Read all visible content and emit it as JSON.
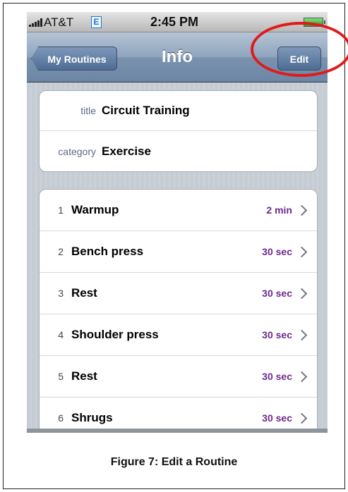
{
  "status_bar": {
    "carrier": "AT&T",
    "network": "E",
    "time": "2:45 PM"
  },
  "nav": {
    "back_label": "My Routines",
    "title": "Info",
    "edit_label": "Edit"
  },
  "info": {
    "rows": [
      {
        "label": "title",
        "value": "Circuit Training"
      },
      {
        "label": "category",
        "value": "Exercise"
      }
    ]
  },
  "steps": [
    {
      "num": "1",
      "name": "Warmup",
      "duration": "2 min"
    },
    {
      "num": "2",
      "name": "Bench press",
      "duration": "30 sec"
    },
    {
      "num": "3",
      "name": "Rest",
      "duration": "30 sec"
    },
    {
      "num": "4",
      "name": "Shoulder press",
      "duration": "30 sec"
    },
    {
      "num": "5",
      "name": "Rest",
      "duration": "30 sec"
    },
    {
      "num": "6",
      "name": "Shrugs",
      "duration": "30 sec"
    }
  ],
  "caption": "Figure 7:  Edit a Routine",
  "colors": {
    "duration": "#6b2a8c",
    "highlight": "#e01a1a",
    "nav_button": "#4e6d94"
  }
}
